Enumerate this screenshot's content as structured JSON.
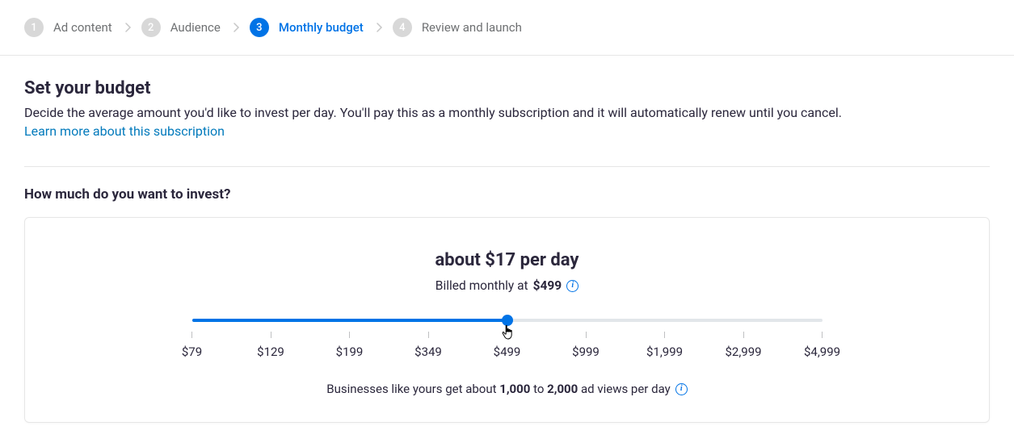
{
  "stepper": {
    "steps": [
      {
        "num": "1",
        "label": "Ad content",
        "active": false
      },
      {
        "num": "2",
        "label": "Audience",
        "active": false
      },
      {
        "num": "3",
        "label": "Monthly budget",
        "active": true
      },
      {
        "num": "4",
        "label": "Review and launch",
        "active": false
      }
    ]
  },
  "heading": "Set your budget",
  "subtext": "Decide the average amount you'd like to invest per day. You'll pay this as a monthly subscription and it will automatically renew until you cancel.",
  "learn_more": "Learn more about this subscription",
  "question": "How much do you want to invest?",
  "budget": {
    "headline": "about $17 per day",
    "billed_prefix": "Billed monthly at ",
    "billed_amount": "$499",
    "ticks": [
      "$79",
      "$129",
      "$199",
      "$349",
      "$499",
      "$999",
      "$1,999",
      "$2,999",
      "$4,999"
    ],
    "selected_index": 4,
    "footnote_prefix": "Businesses like yours get about ",
    "footnote_low": "1,000",
    "footnote_mid": " to ",
    "footnote_high": "2,000",
    "footnote_suffix": " ad views per day"
  }
}
